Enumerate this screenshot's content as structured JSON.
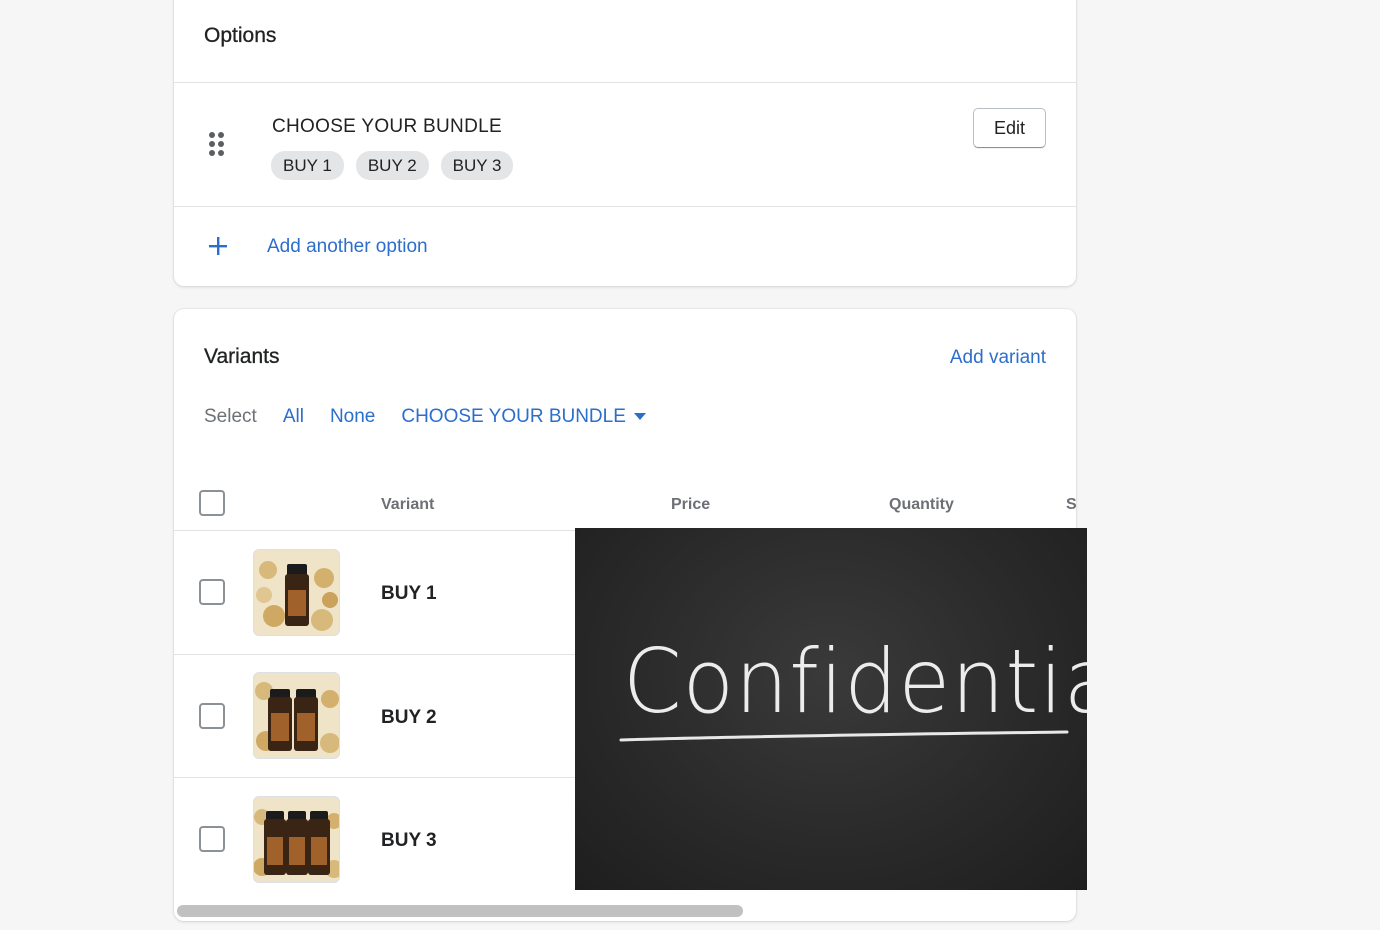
{
  "options": {
    "title": "Options",
    "option_name": "CHOOSE YOUR BUNDLE",
    "values": [
      "BUY 1",
      "BUY 2",
      "BUY 3"
    ],
    "edit_label": "Edit",
    "add_option_label": "Add another option"
  },
  "variants": {
    "title": "Variants",
    "add_variant_label": "Add variant",
    "select": {
      "label": "Select",
      "all": "All",
      "none": "None",
      "bundle": "CHOOSE YOUR BUNDLE"
    },
    "columns": [
      "Variant",
      "Price",
      "Quantity",
      "S"
    ],
    "rows": [
      {
        "label": "BUY 1",
        "bottles": 1
      },
      {
        "label": "BUY 2",
        "bottles": 2
      },
      {
        "label": "BUY 3",
        "bottles": 3
      }
    ]
  },
  "overlay": {
    "text": "Confidential"
  },
  "colors": {
    "link": "#2c6ecb",
    "text": "#202223",
    "subdued": "#6d7175"
  },
  "icons": {
    "drag": "drag-handle-icon",
    "plus": "plus-icon",
    "caret": "caret-down-icon"
  }
}
